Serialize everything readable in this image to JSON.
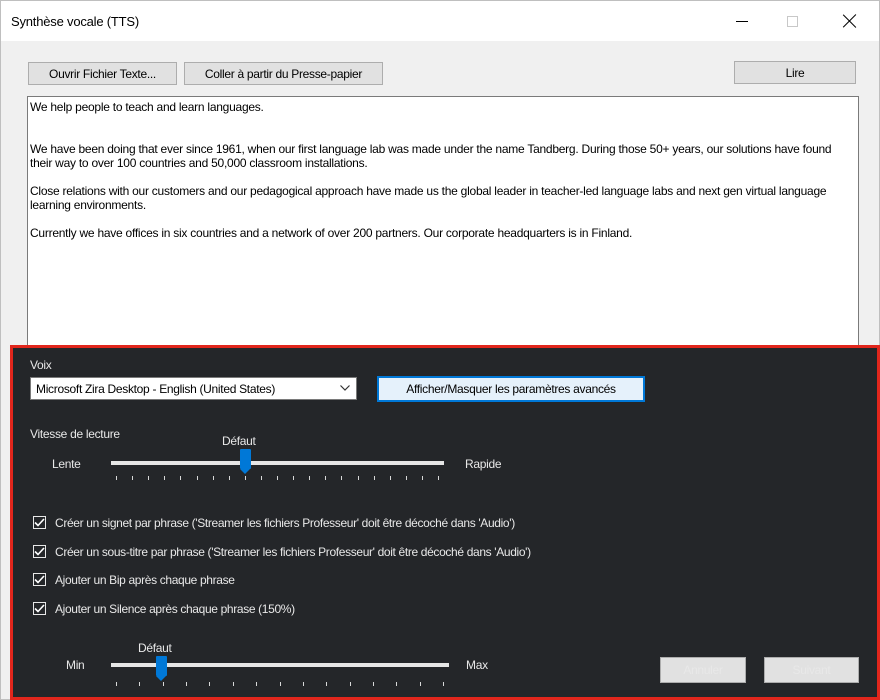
{
  "window": {
    "title": "Synthèse vocale (TTS)",
    "controls": [
      "minimize-icon",
      "maximize-icon",
      "close-icon"
    ]
  },
  "toolbar": {
    "open_label": "Ouvrir Fichier Texte...",
    "paste_label": "Coller à partir du Presse-papier",
    "read_label": "Lire"
  },
  "text": {
    "paragraphs": [
      "We help people to teach and learn languages.",
      "We have been doing that ever since 1961, when our first language lab was made under the name Tandberg. During those 50+ years, our solutions have found their way to over 100 countries and 50,000 classroom installations.",
      "Close relations with our customers and our pedagogical approach have made us the global leader in teacher-led language labs and next gen virtual language learning environments.",
      "Currently we have offices in six countries and a network of over 200 partners. Our corporate headquarters is in Finland."
    ]
  },
  "settings": {
    "voice_label": "Voix",
    "voice_value": "Microsoft Zira Desktop - English (United States)",
    "advanced_label": "Afficher/Masquer les paramètres avancés",
    "speed": {
      "label": "Vitesse de lecture",
      "default_label": "Défaut",
      "min_label": "Lente",
      "max_label": "Rapide",
      "value_fraction": 0.4,
      "tick_count": 21
    },
    "checkboxes": [
      {
        "label": "Créer un signet par phrase ('Streamer les fichiers Professeur' doit être décoché dans 'Audio')",
        "checked": true
      },
      {
        "label": "Créer un sous-titre par phrase ('Streamer les fichiers Professeur' doit être décoché dans 'Audio')",
        "checked": true
      },
      {
        "label": "Ajouter un Bip après chaque phrase",
        "checked": true
      },
      {
        "label": "Ajouter un Silence après chaque phrase (150%)",
        "checked": true
      }
    ],
    "silence": {
      "default_label": "Défaut",
      "min_label": "Min",
      "max_label": "Max",
      "value_fraction": 0.14,
      "tick_count": 15
    }
  },
  "footer": {
    "cancel_label": "Annuler",
    "next_label": "Suivant"
  },
  "colors": {
    "panel_bg": "#242629",
    "panel_border": "#e1261c",
    "accent": "#0078d7"
  }
}
